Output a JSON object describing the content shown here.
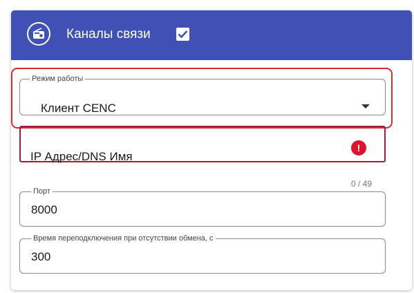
{
  "header": {
    "title": "Каналы связи",
    "enabled": true,
    "icon": "radio-icon",
    "checkbox_icon": "checkbox-checked-icon",
    "background_color": "#3f51b5"
  },
  "mode": {
    "label": "Режим работы",
    "value": "Клиент CENC",
    "highlight_color": "#d32f2f"
  },
  "ip": {
    "placeholder": "IP Адрес/DNS Имя",
    "value": "",
    "counter": "0 / 49",
    "error_icon": "!",
    "error_color": "#e0132f"
  },
  "port": {
    "label": "Порт",
    "value": "8000"
  },
  "reconnect": {
    "label": "Время переподключения при отсутствии обмена, с",
    "value": "300"
  }
}
